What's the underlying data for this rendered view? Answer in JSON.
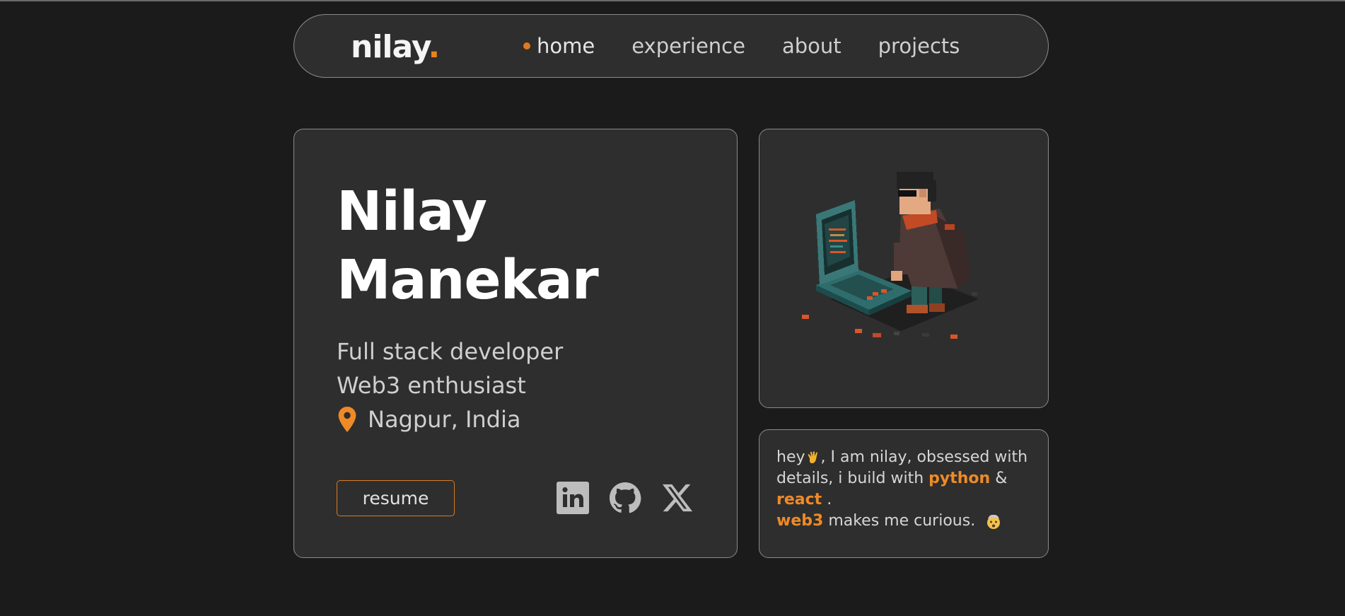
{
  "nav": {
    "logo_text": "nilay",
    "logo_dot": ".",
    "links": [
      {
        "label": "home",
        "active": true
      },
      {
        "label": "experience",
        "active": false
      },
      {
        "label": "about",
        "active": false
      },
      {
        "label": "projects",
        "active": false
      }
    ]
  },
  "hero": {
    "first_name": "Nilay",
    "last_name": "Manekar",
    "roles": [
      "Full stack developer",
      "Web3 enthusiast"
    ],
    "location": "Nagpur, India",
    "location_icon": "map-pin-icon",
    "resume_label": "resume",
    "socials": [
      {
        "name": "linkedin-icon"
      },
      {
        "name": "github-icon"
      },
      {
        "name": "x-icon"
      }
    ]
  },
  "avatar": {
    "icon": "pixel-art-developer-avatar"
  },
  "bio": {
    "greeting": "hey",
    "greeting_emoji": "waving-hand-icon",
    "intro": ", I am nilay, obsessed with details, i build with",
    "tech1": "python",
    "amp": "&",
    "tech2": "react",
    "period": ".",
    "tech3": "web3",
    "outro": "makes me curious.",
    "outro_emoji": "mind-blown-icon"
  },
  "colors": {
    "background": "#1b1b1b",
    "card": "#2e2e2e",
    "accent": "#ef8a26",
    "border": "#8a8a8a"
  }
}
